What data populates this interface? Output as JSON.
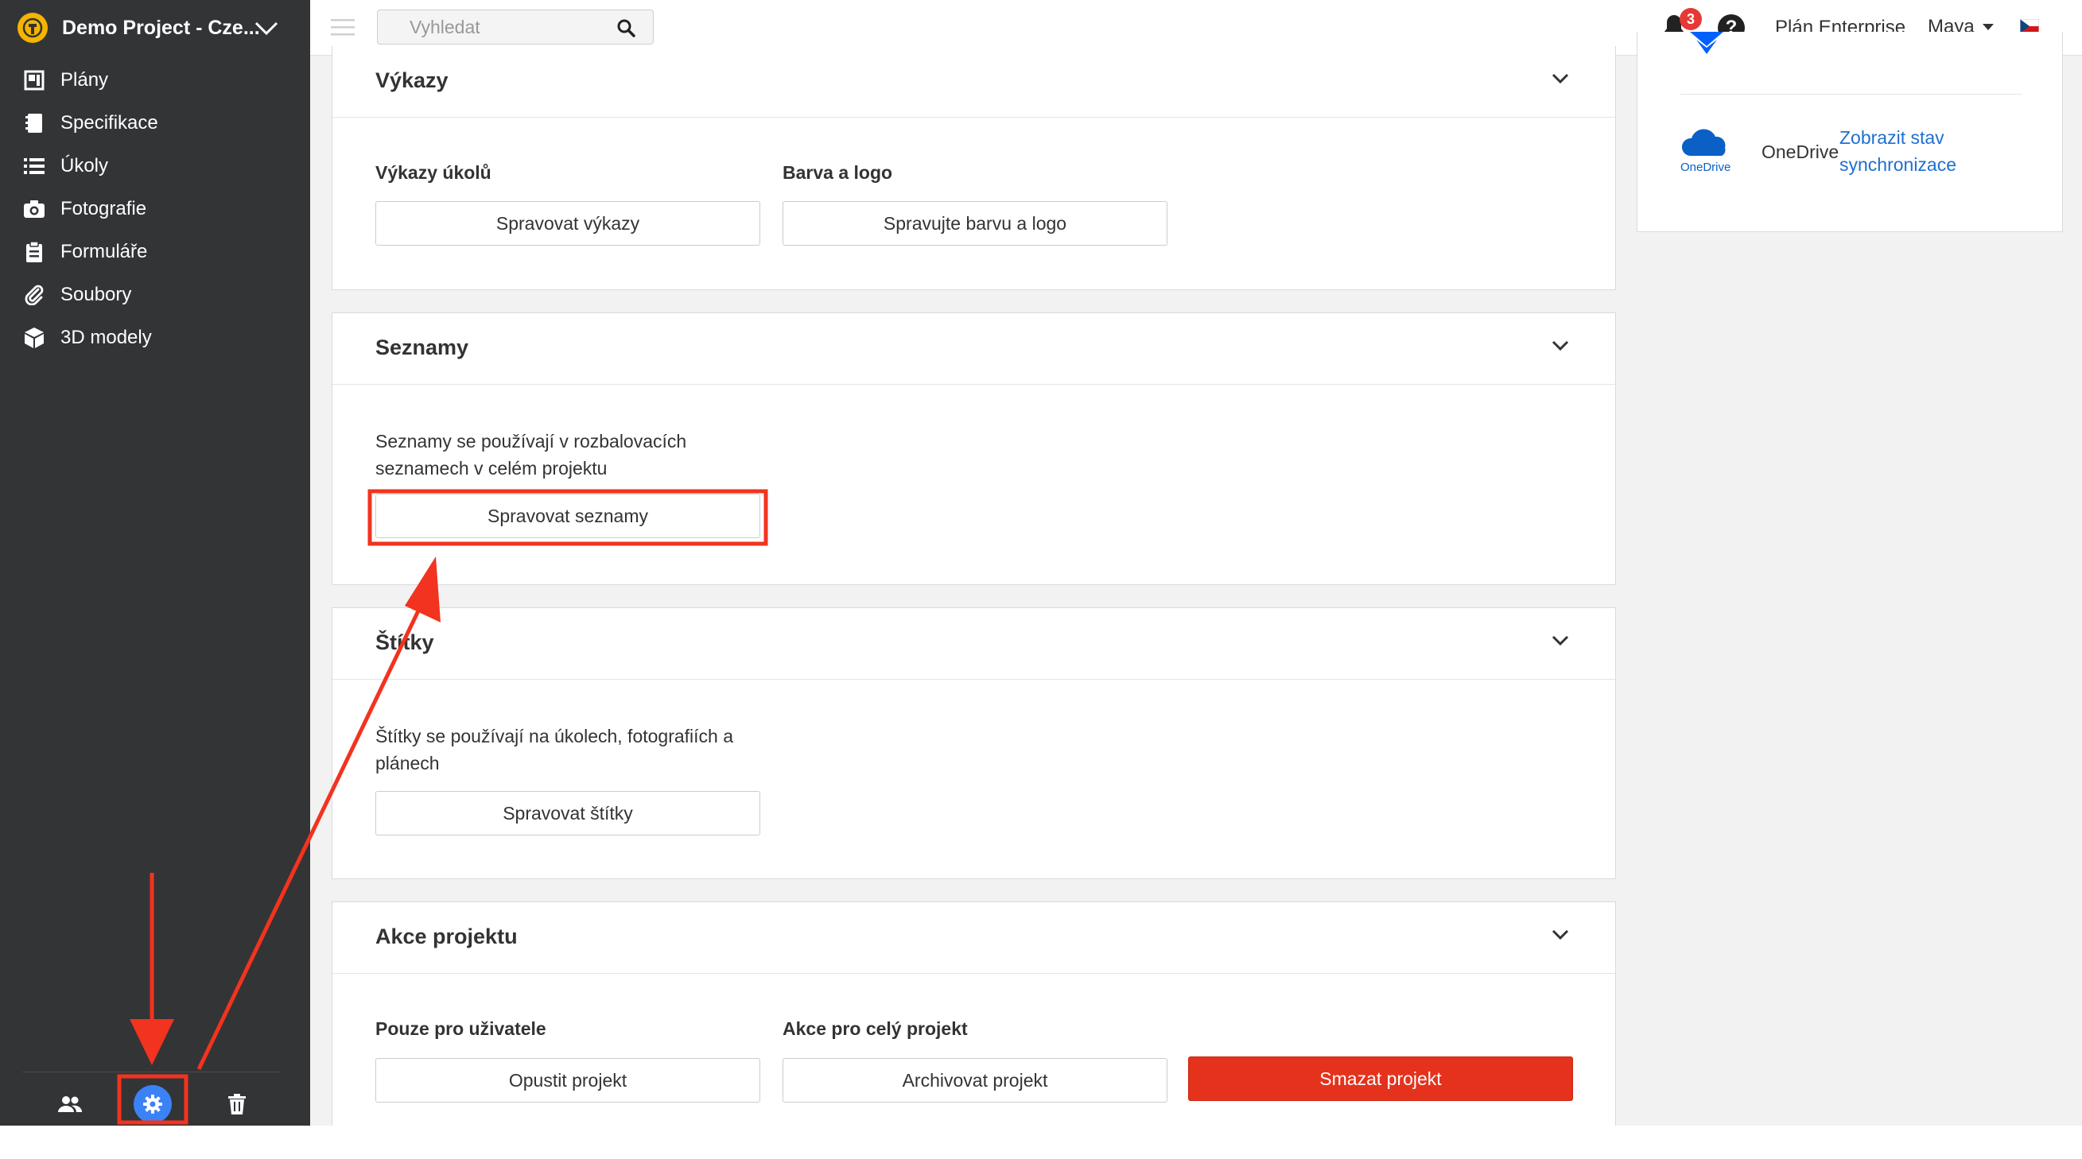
{
  "sidebar": {
    "project_name": "Demo Project - Cze...",
    "items": [
      {
        "label": "Plány",
        "icon": "plans-icon"
      },
      {
        "label": "Specifikace",
        "icon": "specifications-icon"
      },
      {
        "label": "Úkoly",
        "icon": "tasks-list-icon"
      },
      {
        "label": "Fotografie",
        "icon": "camera-icon"
      },
      {
        "label": "Formuláře",
        "icon": "clipboard-icon"
      },
      {
        "label": "Soubory",
        "icon": "paperclip-icon"
      },
      {
        "label": "3D modely",
        "icon": "cube-icon"
      }
    ],
    "footer": [
      "users-icon",
      "settings-gear-icon",
      "trash-icon"
    ]
  },
  "topbar": {
    "search_placeholder": "Vyhledat",
    "notification_count": "3",
    "help": "?",
    "plan": "Plán Enterprise",
    "user": "Maya",
    "language_flag": "czech-flag-icon"
  },
  "sections": {
    "reports": {
      "title": "Výkazy",
      "col1_label": "Výkazy úkolů",
      "col1_button": "Spravovat výkazy",
      "col2_label": "Barva a logo",
      "col2_button": "Spravujte barvu a logo"
    },
    "lists": {
      "title": "Seznamy",
      "description": "Seznamy se používají v rozbalovacích seznamech v celém projektu",
      "button": "Spravovat seznamy"
    },
    "tags": {
      "title": "Štítky",
      "description": "Štítky se používají na úkolech, fotografiích a plánech",
      "button": "Spravovat štítky"
    },
    "project_actions": {
      "title": "Akce projektu",
      "col1_label": "Pouze pro uživatele",
      "col1_button": "Opustit projekt",
      "col2_label": "Akce pro celý projekt",
      "col2_button": "Archivovat projekt",
      "danger_button": "Smazat projekt"
    }
  },
  "integrations": {
    "onedrive_logo_text": "OneDrive",
    "onedrive_name": "OneDrive",
    "sync_link": "Zobrazit stav synchronizace"
  },
  "colors": {
    "sidebar_bg": "#333436",
    "accent_blue": "#3b82f6",
    "danger": "#e5321c",
    "annotation_red": "#f2331f"
  }
}
